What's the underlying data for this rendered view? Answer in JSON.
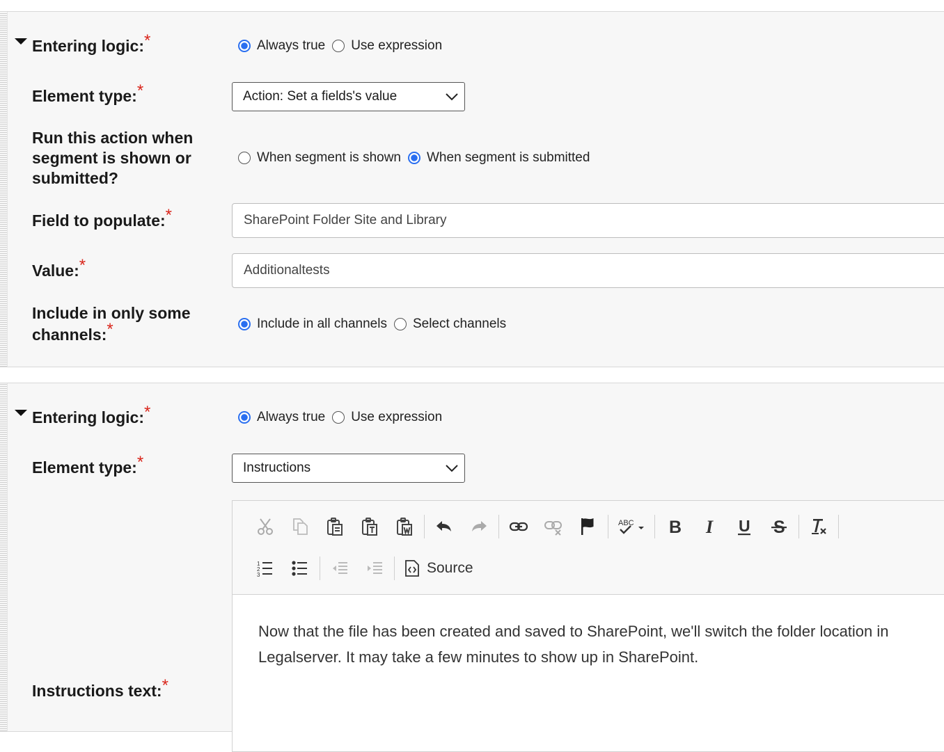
{
  "segment1": {
    "entering_logic": {
      "label": "Entering logic:",
      "options": [
        "Always true",
        "Use expression"
      ],
      "selected": "Always true"
    },
    "element_type": {
      "label": "Element type:",
      "value": "Action: Set a fields's value"
    },
    "run_when": {
      "label": "Run this action when segment is shown or submitted?",
      "options": [
        "When segment is shown",
        "When segment is submitted"
      ],
      "selected": "When segment is submitted"
    },
    "field_to_populate": {
      "label": "Field to populate:",
      "value": "SharePoint Folder Site and Library"
    },
    "value": {
      "label": "Value:",
      "value": "Additionaltests"
    },
    "channels": {
      "label_line1": "Include in only some",
      "label_line2": "channels:",
      "options": [
        "Include in all channels",
        "Select channels"
      ],
      "selected": "Include in all channels"
    }
  },
  "segment2": {
    "entering_logic": {
      "label": "Entering logic:",
      "options": [
        "Always true",
        "Use expression"
      ],
      "selected": "Always true"
    },
    "element_type": {
      "label": "Element type:",
      "value": "Instructions"
    },
    "instructions": {
      "label": "Instructions text:",
      "toolbar": {
        "row1": [
          "cut-icon",
          "copy-icon",
          "paste-icon",
          "paste-text-icon",
          "paste-word-icon",
          "undo-icon",
          "redo-icon",
          "link-icon",
          "unlink-icon",
          "anchor-flag-icon",
          "spellcheck-icon",
          "bold-icon",
          "italic-icon",
          "underline-icon",
          "strikethrough-icon",
          "remove-format-icon"
        ],
        "row2": [
          "numbered-list-icon",
          "bulleted-list-icon",
          "outdent-icon",
          "indent-icon",
          "source-icon"
        ],
        "source_label": "Source",
        "spellcheck_label": "ABC",
        "bold_label": "B",
        "italic_label": "I",
        "underline_label": "U",
        "strike_label": "S"
      },
      "content": "Now that the file has been created and saved to SharePoint, we'll switch the folder location in Legalserver. It may take a few minutes to show up in SharePoint."
    }
  },
  "colors": {
    "required": "#d9261c",
    "radio_selected": "#2a6ff0",
    "panel_bg": "#f7f7f7"
  }
}
